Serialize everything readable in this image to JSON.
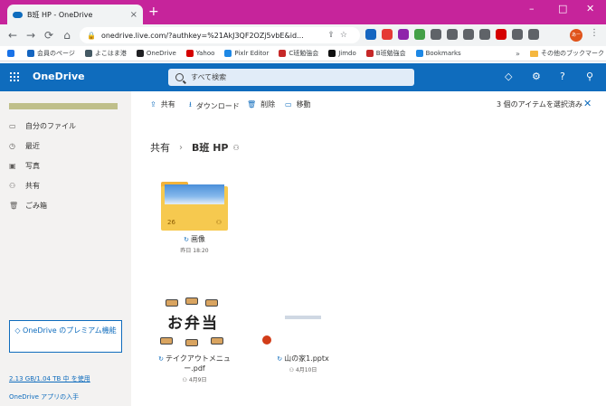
{
  "browser": {
    "tab_title": "B班 HP - OneDrive",
    "tab_close": "×",
    "new_tab": "+",
    "window": {
      "minimize": "–",
      "maximize": "□",
      "close": "✕"
    },
    "nav": {
      "back": "←",
      "forward": "→",
      "reload": "⟳",
      "home": "⌂"
    },
    "url": "onedrive.live.com/?authkey=%21AkJ3QF2OZj5vbE&id...",
    "avatar_text": "あー",
    "ext_colors": [
      "#1565c0",
      "#e53935",
      "#8e24aa",
      "#43a047",
      "#5f6368",
      "#5f6368",
      "#5f6368",
      "#5f6368",
      "#d50000",
      "#5f6368",
      "#5f6368"
    ]
  },
  "bookmarks": {
    "items": [
      {
        "label": "会員のページ",
        "color": "#1565c0"
      },
      {
        "label": "よこはま港",
        "color": "#455a64"
      },
      {
        "label": "OneDrive",
        "color": "#202124"
      },
      {
        "label": "Yahoo",
        "color": "#d50000"
      },
      {
        "label": "Pixlr Editor",
        "color": "#1e88e5"
      },
      {
        "label": "C班勉強会",
        "color": "#c62828"
      },
      {
        "label": "Jimdo",
        "color": "#111111"
      },
      {
        "label": "B班勉強会",
        "color": "#c62828"
      },
      {
        "label": "Bookmarks",
        "color": "#1e88e5"
      }
    ],
    "more": "»",
    "other": "その他のブックマーク"
  },
  "header": {
    "brand": "OneDrive",
    "search_placeholder": "すべて検索"
  },
  "sidebar": {
    "items": [
      {
        "label": "自分のファイル",
        "icon": "▭"
      },
      {
        "label": "最近",
        "icon": "◷"
      },
      {
        "label": "写真",
        "icon": "▣"
      },
      {
        "label": "共有",
        "icon": "⚇"
      },
      {
        "label": "ごみ箱",
        "icon": "🗑"
      }
    ],
    "premium": "OneDrive のプレミアム機能",
    "storage": "2.13 GB/1.04 TB 中 を使用",
    "get_apps": "OneDrive アプリの入手"
  },
  "commands": {
    "share": "共有",
    "download": "ダウンロード",
    "delete": "削除",
    "move": "移動",
    "selected": "3 個のアイテムを選択済み"
  },
  "breadcrumb": {
    "root": "共有",
    "current": "B班 HP"
  },
  "items": [
    {
      "name": "画像",
      "date": "昨日 18:20",
      "count": "26"
    },
    {
      "name": "テイクアウトメニュー.pdf",
      "date": "4月9日",
      "thumb_text": "お弁当"
    },
    {
      "name": "山の家1.pptx",
      "date": "4月10日"
    }
  ]
}
